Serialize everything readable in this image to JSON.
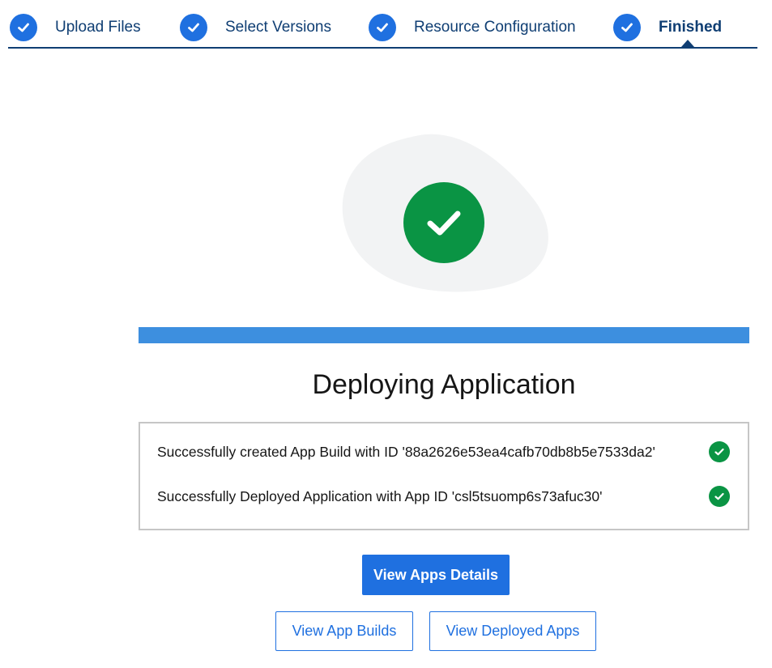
{
  "stepper": {
    "steps": [
      {
        "label": "Upload Files",
        "state": "complete"
      },
      {
        "label": "Select Versions",
        "state": "complete"
      },
      {
        "label": "Resource Configuration",
        "state": "complete"
      },
      {
        "label": "Finished",
        "state": "current"
      }
    ]
  },
  "main": {
    "progress": 1.0,
    "title": "Deploying Application",
    "log": [
      {
        "message": "Successfully created App Build with ID '88a2626e53ea4cafb70db8b5e7533da2'",
        "status": "success"
      },
      {
        "message": "Successfully Deployed Application with App ID 'csl5tsuomp6s73afuc30'",
        "status": "success"
      }
    ]
  },
  "actions": {
    "primary_label": "View Apps Details",
    "builds_label": "View App Builds",
    "deployed_label": "View Deployed Apps"
  },
  "colors": {
    "accent": "#1f70e0",
    "nav_text": "#0f3e73",
    "success": "#0a9444",
    "progress": "#3d8fdf",
    "border": "#c6c6c6"
  },
  "icons": {
    "step": "checkmark-icon",
    "status": "success-check-icon"
  }
}
